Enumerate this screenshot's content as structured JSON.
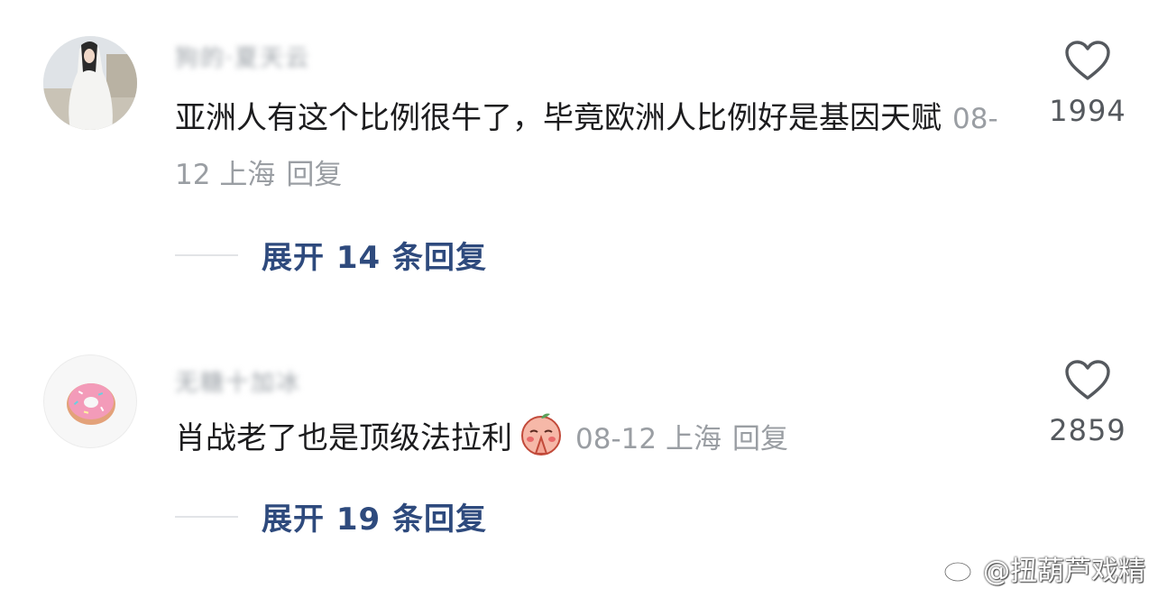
{
  "comments": [
    {
      "username": "狗的·夏天云",
      "text": "亚洲人有这个比例很牛了，毕竟欧洲人比例好是基因天赋",
      "date": "08-12",
      "location": "上海",
      "reply_label": "回复",
      "expand_label": "展开 14 条回复",
      "likes": "1994",
      "avatar_icon": "woman-in-white-dress-photo",
      "inline_emoji": null
    },
    {
      "username": "无糖十加冰",
      "text": "肖战老了也是顶级法拉利",
      "date": "08-12",
      "location": "上海",
      "reply_label": "回复",
      "expand_label": "展开 19 条回复",
      "likes": "2859",
      "avatar_icon": "pink-donut-icon",
      "inline_emoji": "praying-peach-emoji"
    }
  ],
  "watermark": {
    "text": "@扭葫芦戏精",
    "icon": "weibo-logo-icon"
  },
  "colors": {
    "text": "#1c1c1e",
    "meta": "#9a9ea3",
    "expand": "#2e4a7d",
    "like_icon": "#55595e"
  }
}
